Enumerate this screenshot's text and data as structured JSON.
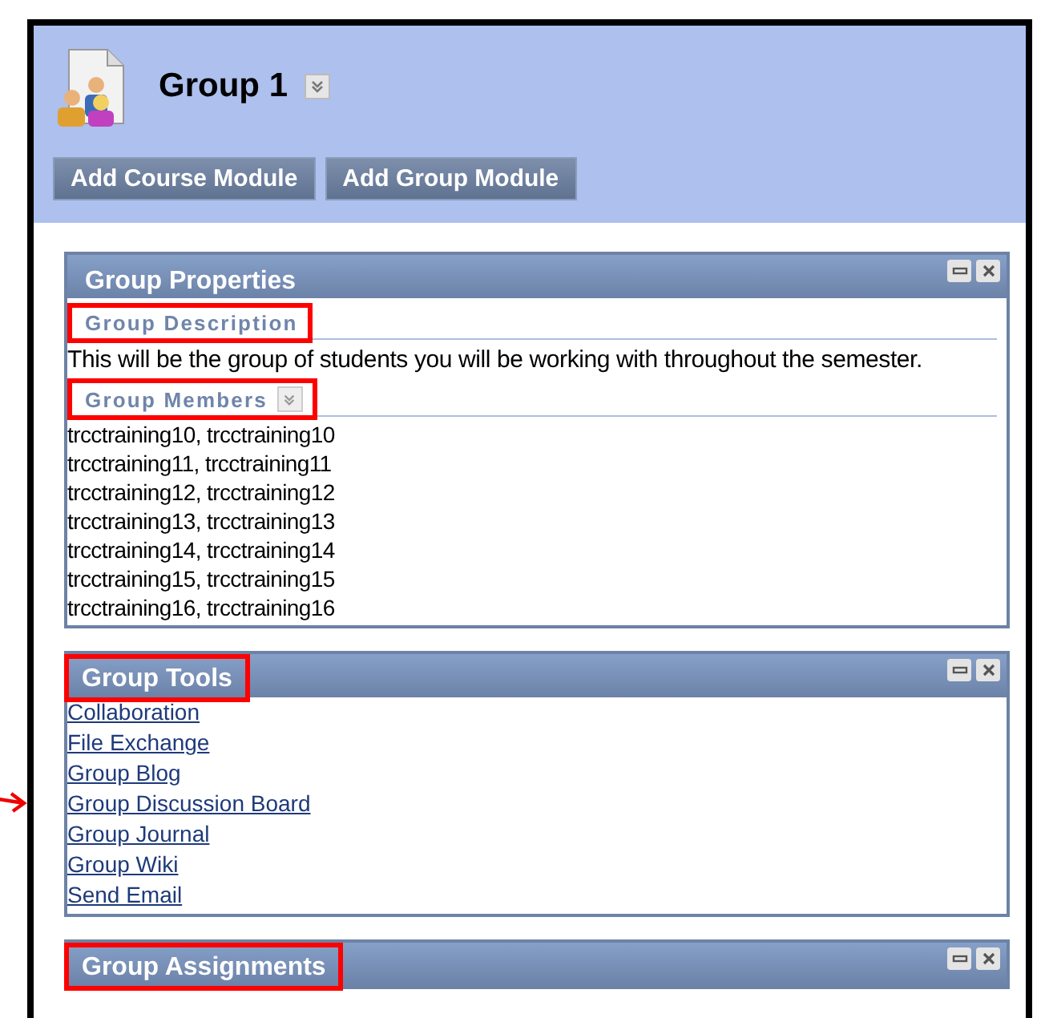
{
  "header": {
    "title": "Group 1",
    "buttons": [
      "Add Course Module",
      "Add Group Module"
    ]
  },
  "panels": [
    {
      "kind": "properties",
      "title": "Group Properties",
      "highlighted": false,
      "sections": [
        {
          "heading": "Group Description",
          "highlighted": true,
          "menu": false,
          "lines": [
            "This will be the group of students you will be working with throughout the semester."
          ]
        },
        {
          "heading": "Group Members",
          "highlighted": true,
          "menu": true,
          "lines": [
            "trcctraining10, trcctraining10",
            "trcctraining11, trcctraining11",
            "trcctraining12, trcctraining12",
            "trcctraining13, trcctraining13",
            "trcctraining14, trcctraining14",
            "trcctraining15, trcctraining15",
            "trcctraining16, trcctraining16"
          ]
        }
      ]
    },
    {
      "kind": "links",
      "title": "Group Tools",
      "highlighted": true,
      "links": [
        {
          "label": "Collaboration",
          "pointed": false
        },
        {
          "label": "File Exchange",
          "pointed": false
        },
        {
          "label": "Group Blog",
          "pointed": false
        },
        {
          "label": "Group Discussion Board",
          "pointed": true
        },
        {
          "label": "Group Journal",
          "pointed": false
        },
        {
          "label": "Group Wiki",
          "pointed": false
        },
        {
          "label": "Send Email",
          "pointed": false
        }
      ]
    },
    {
      "kind": "collapsed",
      "title": "Group Assignments",
      "highlighted": true
    }
  ]
}
